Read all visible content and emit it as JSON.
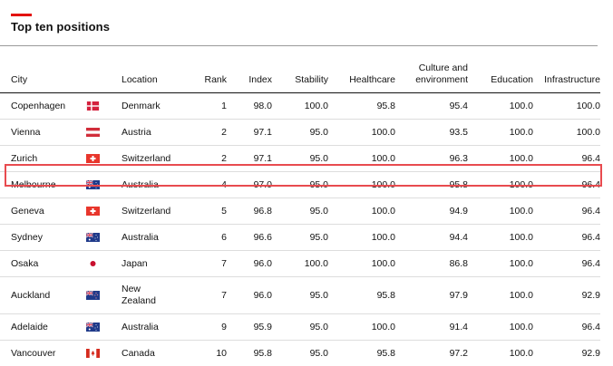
{
  "title": "Top ten positions",
  "columns": {
    "city": "City",
    "location": "Location",
    "rank": "Rank",
    "index": "Index",
    "stability": "Stability",
    "healthcare": "Healthcare",
    "culture_line1": "Culture and",
    "culture_line2": "environment",
    "education": "Education",
    "infrastructure": "Infrastructure"
  },
  "highlight_color": "#e84b4f",
  "accent_color": "#e3120b",
  "rows": [
    {
      "city": "Copenhagen",
      "flag": "denmark-flag-icon",
      "location": "Denmark",
      "location2": "",
      "rank": "1",
      "index": "98.0",
      "stability": "100.0",
      "healthcare": "95.8",
      "culture": "95.4",
      "education": "100.0",
      "infrastructure": "100.0"
    },
    {
      "city": "Vienna",
      "flag": "austria-flag-icon",
      "location": "Austria",
      "location2": "",
      "rank": "2",
      "index": "97.1",
      "stability": "95.0",
      "healthcare": "100.0",
      "culture": "93.5",
      "education": "100.0",
      "infrastructure": "100.0"
    },
    {
      "city": "Zurich",
      "flag": "switzerland-flag-icon",
      "location": "Switzerland",
      "location2": "",
      "rank": "2",
      "index": "97.1",
      "stability": "95.0",
      "healthcare": "100.0",
      "culture": "96.3",
      "education": "100.0",
      "infrastructure": "96.4"
    },
    {
      "city": "Melbourne",
      "flag": "australia-flag-icon",
      "location": "Australia",
      "location2": "",
      "rank": "4",
      "index": "97.0",
      "stability": "95.0",
      "healthcare": "100.0",
      "culture": "95.8",
      "education": "100.0",
      "infrastructure": "96.4"
    },
    {
      "city": "Geneva",
      "flag": "switzerland-flag-icon",
      "location": "Switzerland",
      "location2": "",
      "rank": "5",
      "index": "96.8",
      "stability": "95.0",
      "healthcare": "100.0",
      "culture": "94.9",
      "education": "100.0",
      "infrastructure": "96.4"
    },
    {
      "city": "Sydney",
      "flag": "australia-flag-icon",
      "location": "Australia",
      "location2": "",
      "rank": "6",
      "index": "96.6",
      "stability": "95.0",
      "healthcare": "100.0",
      "culture": "94.4",
      "education": "100.0",
      "infrastructure": "96.4"
    },
    {
      "city": "Osaka",
      "flag": "japan-flag-icon",
      "location": "Japan",
      "location2": "",
      "rank": "7",
      "index": "96.0",
      "stability": "100.0",
      "healthcare": "100.0",
      "culture": "86.8",
      "education": "100.0",
      "infrastructure": "96.4"
    },
    {
      "city": "Auckland",
      "flag": "new-zealand-flag-icon",
      "location": "New",
      "location2": "Zealand",
      "rank": "7",
      "index": "96.0",
      "stability": "95.0",
      "healthcare": "95.8",
      "culture": "97.9",
      "education": "100.0",
      "infrastructure": "92.9"
    },
    {
      "city": "Adelaide",
      "flag": "australia-flag-icon",
      "location": "Australia",
      "location2": "",
      "rank": "9",
      "index": "95.9",
      "stability": "95.0",
      "healthcare": "100.0",
      "culture": "91.4",
      "education": "100.0",
      "infrastructure": "96.4"
    },
    {
      "city": "Vancouver",
      "flag": "canada-flag-icon",
      "location": "Canada",
      "location2": "",
      "rank": "10",
      "index": "95.8",
      "stability": "95.0",
      "healthcare": "95.8",
      "culture": "97.2",
      "education": "100.0",
      "infrastructure": "92.9"
    }
  ]
}
